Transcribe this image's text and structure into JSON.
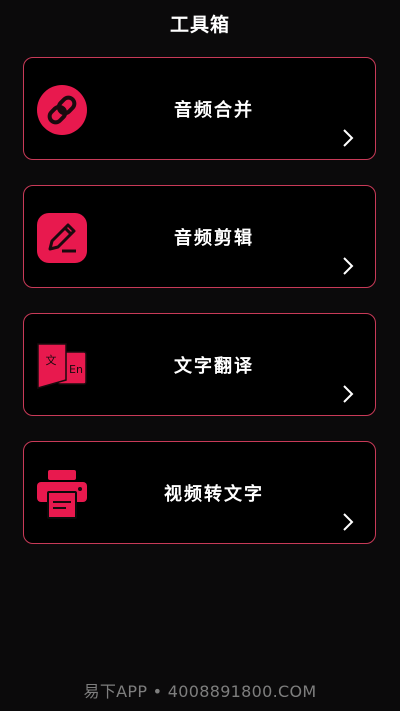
{
  "header": {
    "title": "工具箱"
  },
  "tools": [
    {
      "label": "音频合并",
      "icon": "link-icon"
    },
    {
      "label": "音频剪辑",
      "icon": "edit-icon"
    },
    {
      "label": "文字翻译",
      "icon": "translate-icon",
      "icon_text_a": "文",
      "icon_text_b": "En"
    },
    {
      "label": "视频转文字",
      "icon": "printer-icon"
    }
  ],
  "watermark": "易下APP • 4008891800.COM",
  "colors": {
    "accent": "#e8194e",
    "border": "#c83a58",
    "background": "#0b0a0b"
  }
}
